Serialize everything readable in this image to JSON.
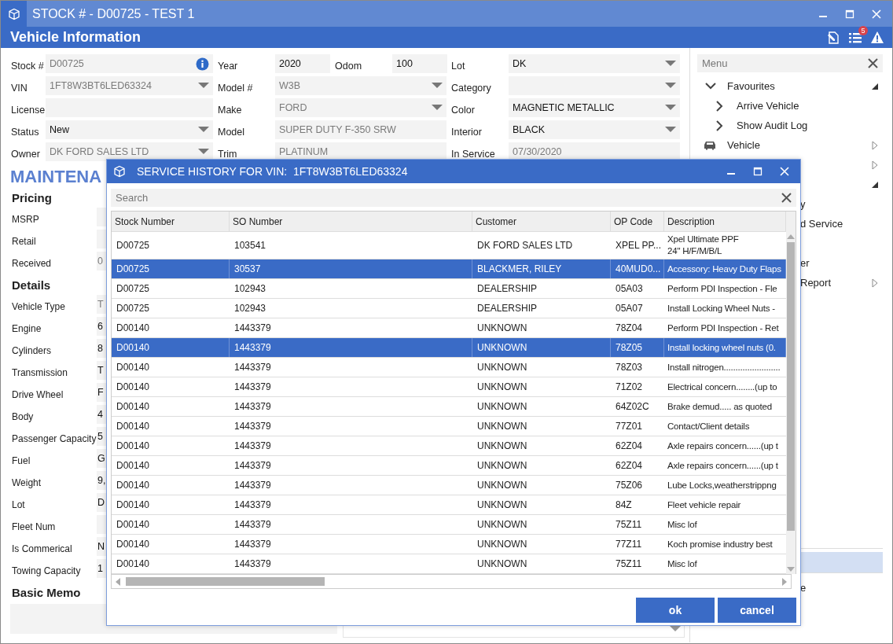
{
  "window": {
    "title": "STOCK # - D00725 - TEST 1"
  },
  "header": {
    "title": "Vehicle Information",
    "badge": "5"
  },
  "form": {
    "columns": [
      [
        [
          {
            "label": "Stock #",
            "value": "D00725",
            "disabled": true,
            "dropdown": false,
            "info": true
          }
        ],
        [
          {
            "label": "VIN",
            "value": "1FT8W3BT6LED63324",
            "disabled": true,
            "dropdown": true
          }
        ],
        [
          {
            "label": "License",
            "dropdown": false
          }
        ],
        [
          {
            "label": "Status",
            "value": "New",
            "disabled": false,
            "dropdown": true
          }
        ],
        [
          {
            "label": "Owner",
            "value": "DK FORD SALES LTD",
            "disabled": true,
            "dropdown": true
          }
        ]
      ],
      [
        [
          {
            "label": "Year",
            "value": "2020",
            "disabled": false,
            "dropdown": false
          },
          {
            "label": "Odom",
            "value": "100",
            "disabled": false,
            "dropdown": false
          }
        ],
        [
          {
            "label": "Model #",
            "value": "W3B",
            "disabled": true,
            "dropdown": true
          }
        ],
        [
          {
            "label": "Make",
            "value": "FORD",
            "disabled": true,
            "dropdown": true
          }
        ],
        [
          {
            "label": "Model",
            "value": "SUPER DUTY F-350 SRW",
            "disabled": true,
            "dropdown": false
          }
        ],
        [
          {
            "label": "Trim",
            "value": "PLATINUM",
            "disabled": true,
            "dropdown": false
          }
        ]
      ],
      [
        [
          {
            "label": "Lot",
            "value": "DK",
            "disabled": false,
            "dropdown": true
          }
        ],
        [
          {
            "label": "Category",
            "dropdown": true
          }
        ],
        [
          {
            "label": "Color",
            "value": "MAGNETIC METALLIC",
            "disabled": false,
            "dropdown": true
          }
        ],
        [
          {
            "label": "Interior",
            "value": "BLACK",
            "disabled": false,
            "dropdown": true
          }
        ],
        [
          {
            "label": "In Service",
            "value": "07/30/2020",
            "disabled": true,
            "dropdown": false
          }
        ]
      ]
    ]
  },
  "section_heading": "MAINTENA",
  "groups": [
    {
      "title": "Pricing",
      "fields": [
        {
          "label": "MSRP"
        },
        {
          "label": "Retail"
        },
        {
          "label": "Received",
          "value": "0",
          "disabled": true
        }
      ]
    },
    {
      "title": "Details",
      "fields": [
        {
          "label": "Vehicle Type",
          "value": "T",
          "disabled": true
        },
        {
          "label": "Engine",
          "value": "6",
          "disabled": false
        },
        {
          "label": "Cylinders",
          "value": "8",
          "disabled": false
        },
        {
          "label": "Transmission",
          "value": "T",
          "disabled": false
        },
        {
          "label": "Drive Wheel",
          "value": "F",
          "disabled": false
        },
        {
          "label": "Body",
          "value": "4",
          "disabled": false
        },
        {
          "label": "Passenger Capacity",
          "value": "5",
          "disabled": false
        },
        {
          "label": "Fuel",
          "value": "G",
          "disabled": false
        },
        {
          "label": "Weight",
          "value": "9,",
          "disabled": false
        },
        {
          "label": "Lot",
          "value": "D",
          "disabled": false
        },
        {
          "label": "Fleet Num"
        },
        {
          "label": "Is Commerical",
          "value": "N",
          "disabled": false
        },
        {
          "label": "Towing Capacity",
          "value": "1",
          "disabled": false
        }
      ]
    },
    {
      "title": "Basic Memo"
    }
  ],
  "menu": {
    "placeholder": "Menu",
    "rows": [
      {
        "kind": "group",
        "label": "Favourites",
        "expanded": true,
        "selected": false
      },
      {
        "kind": "link",
        "label": "Arrive Vehicle",
        "selected": false
      },
      {
        "kind": "link",
        "label": "Show Audit Log",
        "selected": false
      },
      {
        "kind": "category",
        "label": "Vehicle",
        "submenu": true,
        "selected": false
      },
      {
        "kind": "covered",
        "submenu": true,
        "selected": false
      },
      {
        "kind": "covered",
        "expanded": true,
        "selected": false
      },
      {
        "kind": "fragment",
        "label": "y",
        "selected": false
      },
      {
        "kind": "fragment",
        "label": "d Service",
        "selected": false
      },
      {
        "kind": "covered",
        "selected": false
      },
      {
        "kind": "fragment",
        "label": "er",
        "selected": false
      },
      {
        "kind": "fragment",
        "label": "Report",
        "submenu": true,
        "selected": false
      }
    ],
    "lower_rows": [
      {
        "kind": "covered",
        "selected": true
      },
      {
        "kind": "fragment",
        "label": "e",
        "selected": false
      }
    ]
  },
  "dialog": {
    "title": "SERVICE HISTORY FOR VIN:  1FT8W3BT6LED63324",
    "search_placeholder": "Search",
    "columns": [
      "Stock Number",
      "SO Number",
      "Customer",
      "OP Code",
      "Description"
    ],
    "rows": [
      {
        "cells": [
          "D00725",
          "103541",
          "DK FORD SALES LTD",
          "XPEL PP...",
          "Xpel Ultimate PPF\n24\" H/F/M/B/L"
        ],
        "selected": false
      },
      {
        "cells": [
          "D00725",
          "30537",
          "BLACKMER, RILEY",
          "40MUD0...",
          "Accessory: Heavy Duty Flaps"
        ],
        "selected": true
      },
      {
        "cells": [
          "D00725",
          "102943",
          "DEALERSHIP",
          "05A03",
          "Perform PDI Inspection - Fle"
        ],
        "selected": false
      },
      {
        "cells": [
          "D00725",
          "102943",
          "DEALERSHIP",
          "05A07",
          "Install Locking Wheel Nuts -"
        ],
        "selected": false
      },
      {
        "cells": [
          "D00140",
          "1443379",
          "UNKNOWN",
          "78Z04",
          "Perform PDI Inspection - Ret"
        ],
        "selected": false
      },
      {
        "cells": [
          "D00140",
          "1443379",
          "UNKNOWN",
          "78Z05",
          "Install locking wheel nuts (0."
        ],
        "selected": true
      },
      {
        "cells": [
          "D00140",
          "1443379",
          "UNKNOWN",
          "78Z03",
          "Install nitrogen........................"
        ],
        "selected": false
      },
      {
        "cells": [
          "D00140",
          "1443379",
          "UNKNOWN",
          "71Z02",
          "Electrical concern........(up to"
        ],
        "selected": false
      },
      {
        "cells": [
          "D00140",
          "1443379",
          "UNKNOWN",
          "64Z02C",
          "Brake demud..... as quoted"
        ],
        "selected": false
      },
      {
        "cells": [
          "D00140",
          "1443379",
          "UNKNOWN",
          "77Z01",
          "Contact/Client details"
        ],
        "selected": false
      },
      {
        "cells": [
          "D00140",
          "1443379",
          "UNKNOWN",
          "62Z04",
          "Axle repairs concern......(up t"
        ],
        "selected": false
      },
      {
        "cells": [
          "D00140",
          "1443379",
          "UNKNOWN",
          "62Z04",
          "Axle repairs concern......(up t"
        ],
        "selected": false
      },
      {
        "cells": [
          "D00140",
          "1443379",
          "UNKNOWN",
          "75Z06",
          "Lube Locks,weatherstrippng"
        ],
        "selected": false
      },
      {
        "cells": [
          "D00140",
          "1443379",
          "UNKNOWN",
          "84Z",
          "Fleet vehicle repair"
        ],
        "selected": false
      },
      {
        "cells": [
          "D00140",
          "1443379",
          "UNKNOWN",
          "75Z11",
          "Misc lof"
        ],
        "selected": false
      },
      {
        "cells": [
          "D00140",
          "1443379",
          "UNKNOWN",
          "77Z11",
          "Koch promise industry best"
        ],
        "selected": false
      },
      {
        "cells": [
          "D00140",
          "1443379",
          "UNKNOWN",
          "75Z11",
          "Misc lof"
        ],
        "selected": false
      }
    ],
    "buttons": [
      "ok",
      "cancel"
    ]
  }
}
